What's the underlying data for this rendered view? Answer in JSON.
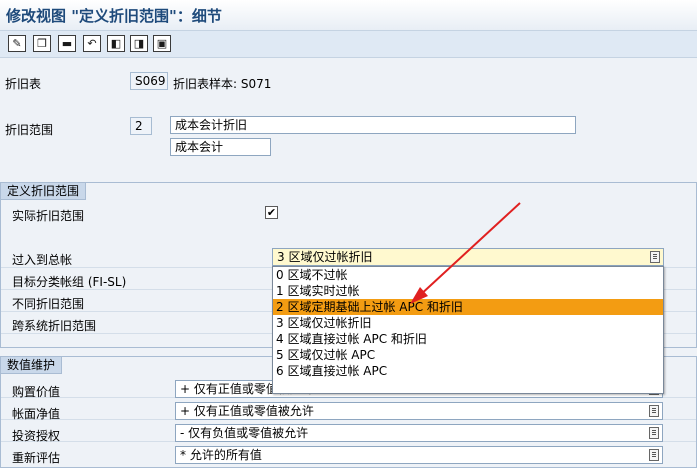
{
  "window": {
    "title": "修改视图 \"定义折旧范围\"：细节"
  },
  "toolbar": {
    "buttons": [
      {
        "name": "edit-pencil-icon"
      },
      {
        "name": "copy-icon"
      },
      {
        "name": "delete-icon"
      },
      {
        "name": "undo-icon"
      },
      {
        "name": "previous-entry-icon"
      },
      {
        "name": "next-entry-icon"
      },
      {
        "name": "other-entry-icon"
      }
    ]
  },
  "header": {
    "chart_label": "折旧表",
    "chart_value": "S069",
    "chart_sample": "折旧表样本: S071",
    "area_label": "折旧范围",
    "area_value": "2",
    "area_long": "成本会计折旧",
    "area_short": "成本会计"
  },
  "define_group": {
    "title": "定义折旧范围",
    "actual_label": "实际折旧范围",
    "actual_checked": "✔",
    "posting_label": "过入到总帐",
    "posting_value": "3 区域仅过帐折旧",
    "target_label": "目标分类帐组 (FI-SL)",
    "diff_label": "不同折旧范围",
    "cross_label": "跨系统折旧范围",
    "options": [
      "0 区域不过帐",
      "1 区域实时过帐",
      "2 区域定期基础上过帐 APC 和折旧",
      "3 区域仅过帐折旧",
      "4 区域直接过帐 APC 和折旧",
      "5 区域仅过帐 APC",
      "6 区域直接过帐 APC"
    ],
    "selected_index": 2
  },
  "values_group": {
    "title": "数值维护",
    "rows": [
      {
        "label": "购置价值",
        "value": "+ 仅有正值或零值被允许"
      },
      {
        "label": "帐面净值",
        "value": "+ 仅有正值或零值被允许"
      },
      {
        "label": "投资授权",
        "value": "- 仅有负值或零值被允许"
      },
      {
        "label": "重新评估",
        "value": "* 允许的所有值"
      }
    ]
  },
  "colors": {
    "highlight": "#f39c12",
    "arrow": "#e02020",
    "accent": "#1e4a7b"
  }
}
